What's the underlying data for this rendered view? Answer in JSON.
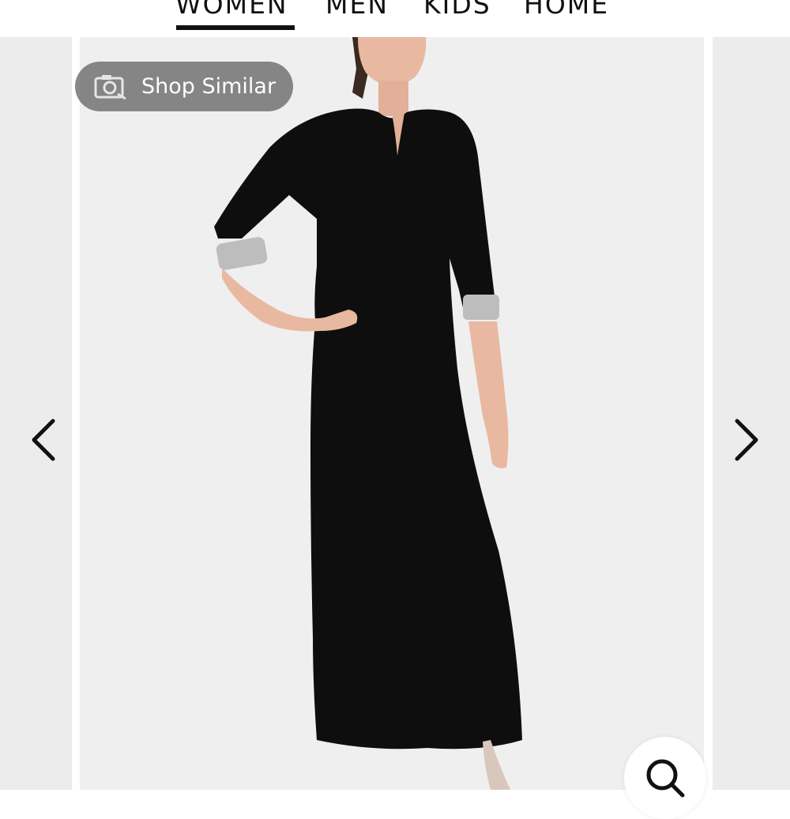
{
  "nav": {
    "tabs": [
      {
        "label": "WOMEN",
        "active": true
      },
      {
        "label": "MEN",
        "active": false
      },
      {
        "label": "KIDS",
        "active": false
      },
      {
        "label": "HOME",
        "active": false
      }
    ]
  },
  "gallery": {
    "shop_similar_label": "Shop Similar",
    "prev_icon": "chevron-left-icon",
    "next_icon": "chevron-right-icon",
    "zoom_icon": "magnifier-icon"
  },
  "colors": {
    "accent": "#111111",
    "background": "#efefef",
    "pill": "#6e6e6e"
  }
}
